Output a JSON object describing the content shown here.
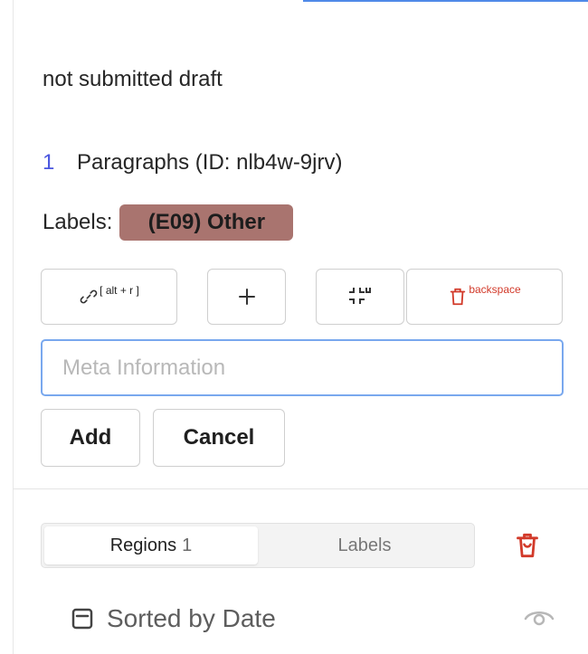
{
  "status": {
    "text": "not submitted draft"
  },
  "paragraph": {
    "number": "1",
    "text": "Paragraphs (ID: nlb4w-9jrv)"
  },
  "labels": {
    "title": "Labels:",
    "chip": "(E09) Other",
    "chip_color": "#a9746f"
  },
  "toolbar": {
    "link_icon": "link-icon",
    "link_shortcut": "[ alt + r ]",
    "add_icon": "plus-icon",
    "collapse_icon": "collapse-icon",
    "delete_icon": "trash-icon",
    "delete_shortcut": "backspace",
    "delete_color": "#d23a2a"
  },
  "meta": {
    "placeholder": "Meta Information",
    "value": "",
    "add_label": "Add",
    "cancel_label": "Cancel",
    "focus_color": "#79a8ee"
  },
  "panel": {
    "tabs": [
      {
        "label": "Regions",
        "count": "1",
        "active": true
      },
      {
        "label": "Labels",
        "count": "",
        "active": false
      }
    ],
    "trash_icon": "trash-icon",
    "trash_color": "#d23a2a"
  },
  "sort": {
    "icon": "sort-icon",
    "label": "Sorted by Date",
    "visibility_icon": "eye-icon"
  },
  "accent_color": "#4f8ae8"
}
